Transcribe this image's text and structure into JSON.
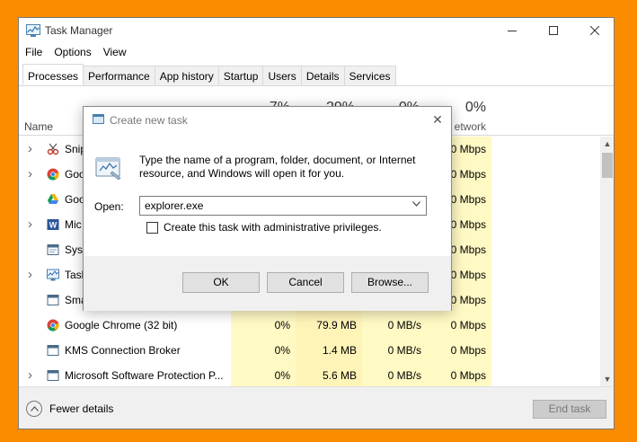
{
  "window": {
    "title": "Task Manager",
    "menu": [
      "File",
      "Options",
      "View"
    ],
    "tabs": [
      "Processes",
      "Performance",
      "App history",
      "Startup",
      "Users",
      "Details",
      "Services"
    ],
    "active_tab": "Processes"
  },
  "columns": {
    "name": "Name",
    "cpu_pct": "7%",
    "mem_pct": "29%",
    "disk_pct": "0%",
    "net_pct": "0%",
    "net_label": "etwork"
  },
  "processes": [
    {
      "name": "Snip",
      "expandable": true,
      "icon": "snipping-tool-icon",
      "cpu": "",
      "mem": "",
      "disk": "",
      "net": "0 Mbps"
    },
    {
      "name": "Goo",
      "expandable": true,
      "icon": "chrome-icon",
      "cpu": "",
      "mem": "",
      "disk": "",
      "net": "0 Mbps"
    },
    {
      "name": "Goo",
      "expandable": false,
      "icon": "google-drive-icon",
      "cpu": "",
      "mem": "",
      "disk": "",
      "net": "0 Mbps"
    },
    {
      "name": "Mic",
      "expandable": true,
      "icon": "word-icon",
      "cpu": "",
      "mem": "",
      "disk": "",
      "net": "0 Mbps"
    },
    {
      "name": "Syst",
      "expandable": false,
      "icon": "system-icon",
      "cpu": "",
      "mem": "",
      "disk": "",
      "net": "0 Mbps"
    },
    {
      "name": "Task",
      "expandable": true,
      "icon": "task-manager-icon",
      "cpu": "",
      "mem": "",
      "disk": "",
      "net": "0 Mbps"
    },
    {
      "name": "Sma",
      "expandable": false,
      "icon": "app-window-icon",
      "cpu": "",
      "mem": "",
      "disk": "",
      "net": "0 Mbps"
    },
    {
      "name": "Google Chrome (32 bit)",
      "expandable": false,
      "icon": "chrome-icon",
      "cpu": "0%",
      "mem": "79.9 MB",
      "disk": "0 MB/s",
      "net": "0 Mbps"
    },
    {
      "name": "KMS Connection Broker",
      "expandable": false,
      "icon": "app-window-icon",
      "cpu": "0%",
      "mem": "1.4 MB",
      "disk": "0 MB/s",
      "net": "0 Mbps"
    },
    {
      "name": "Microsoft Software Protection P...",
      "expandable": true,
      "icon": "app-window-icon",
      "cpu": "0%",
      "mem": "5.6 MB",
      "disk": "0 MB/s",
      "net": "0 Mbps"
    }
  ],
  "footer": {
    "fewer_details": "Fewer details",
    "end_task": "End task"
  },
  "dialog": {
    "title": "Create new task",
    "description": "Type the name of a program, folder, document, or Internet resource, and Windows will open it for you.",
    "open_label": "Open:",
    "open_value": "explorer.exe",
    "admin_checkbox_label": "Create this task with administrative privileges.",
    "admin_checked": false,
    "ok": "OK",
    "cancel": "Cancel",
    "browse": "Browse..."
  },
  "colors": {
    "background": "#fb8c00",
    "highlight_light": "#fff9c4",
    "highlight_mid": "#fff4b8"
  }
}
